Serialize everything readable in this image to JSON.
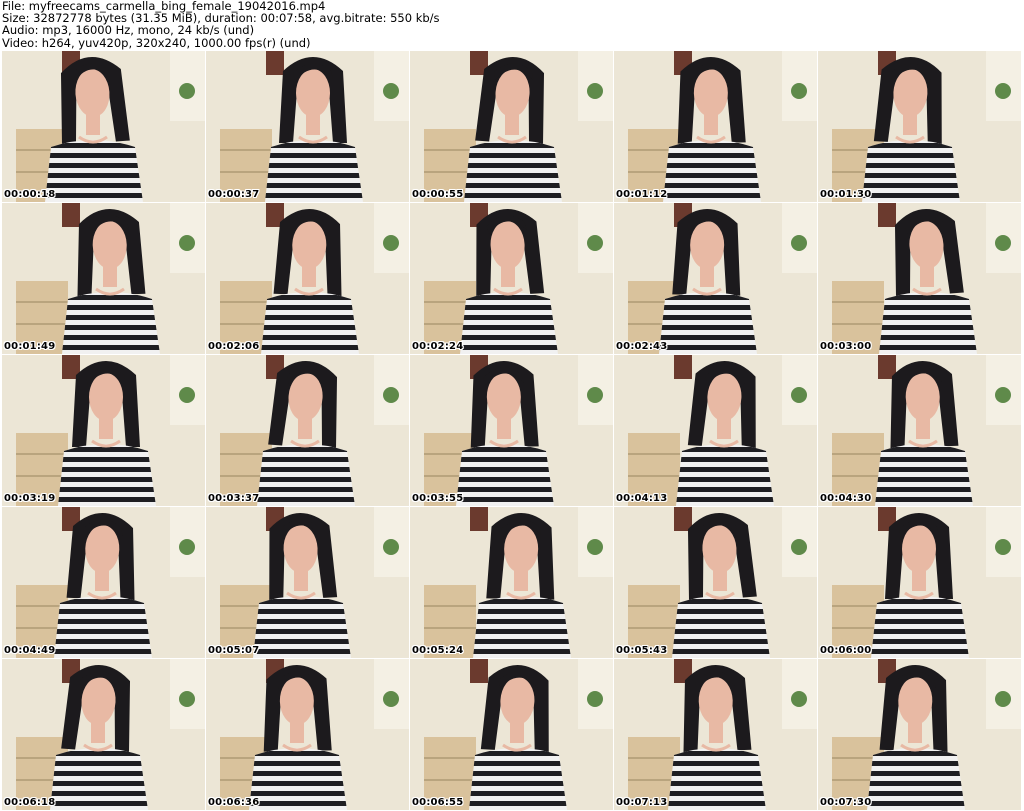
{
  "header": {
    "file_line": "File: myfreecams_carmella_bing_female_19042016.mp4",
    "size_line": "Size: 32872778 bytes (31.35 MiB), duration: 00:07:58, avg.bitrate: 550 kb/s",
    "audio_line": "Audio: mp3, 16000 Hz, mono, 24 kb/s (und)",
    "video_line": "Video: h264, yuv420p, 320x240, 1000.00 fps(r) (und)"
  },
  "thumbnails": [
    {
      "timestamp": "00:00:18"
    },
    {
      "timestamp": "00:00:37"
    },
    {
      "timestamp": "00:00:55"
    },
    {
      "timestamp": "00:01:12"
    },
    {
      "timestamp": "00:01:30"
    },
    {
      "timestamp": "00:01:49"
    },
    {
      "timestamp": "00:02:06"
    },
    {
      "timestamp": "00:02:24"
    },
    {
      "timestamp": "00:02:43"
    },
    {
      "timestamp": "00:03:00"
    },
    {
      "timestamp": "00:03:19"
    },
    {
      "timestamp": "00:03:37"
    },
    {
      "timestamp": "00:03:55"
    },
    {
      "timestamp": "00:04:13"
    },
    {
      "timestamp": "00:04:30"
    },
    {
      "timestamp": "00:04:49"
    },
    {
      "timestamp": "00:05:07"
    },
    {
      "timestamp": "00:05:24"
    },
    {
      "timestamp": "00:05:43"
    },
    {
      "timestamp": "00:06:00"
    },
    {
      "timestamp": "00:06:18"
    },
    {
      "timestamp": "00:06:36"
    },
    {
      "timestamp": "00:06:55"
    },
    {
      "timestamp": "00:07:13"
    },
    {
      "timestamp": "00:07:30"
    }
  ],
  "colors": {
    "wall": "#ece6d6",
    "cabinet": "#d9c29c",
    "frame": "#6b3a2e",
    "hair": "#1c1a1d",
    "skin": "#e8b9a4",
    "stripe_dark": "#1e1e22",
    "stripe_light": "#f1f1f1",
    "timestamp_text": "#000000"
  }
}
